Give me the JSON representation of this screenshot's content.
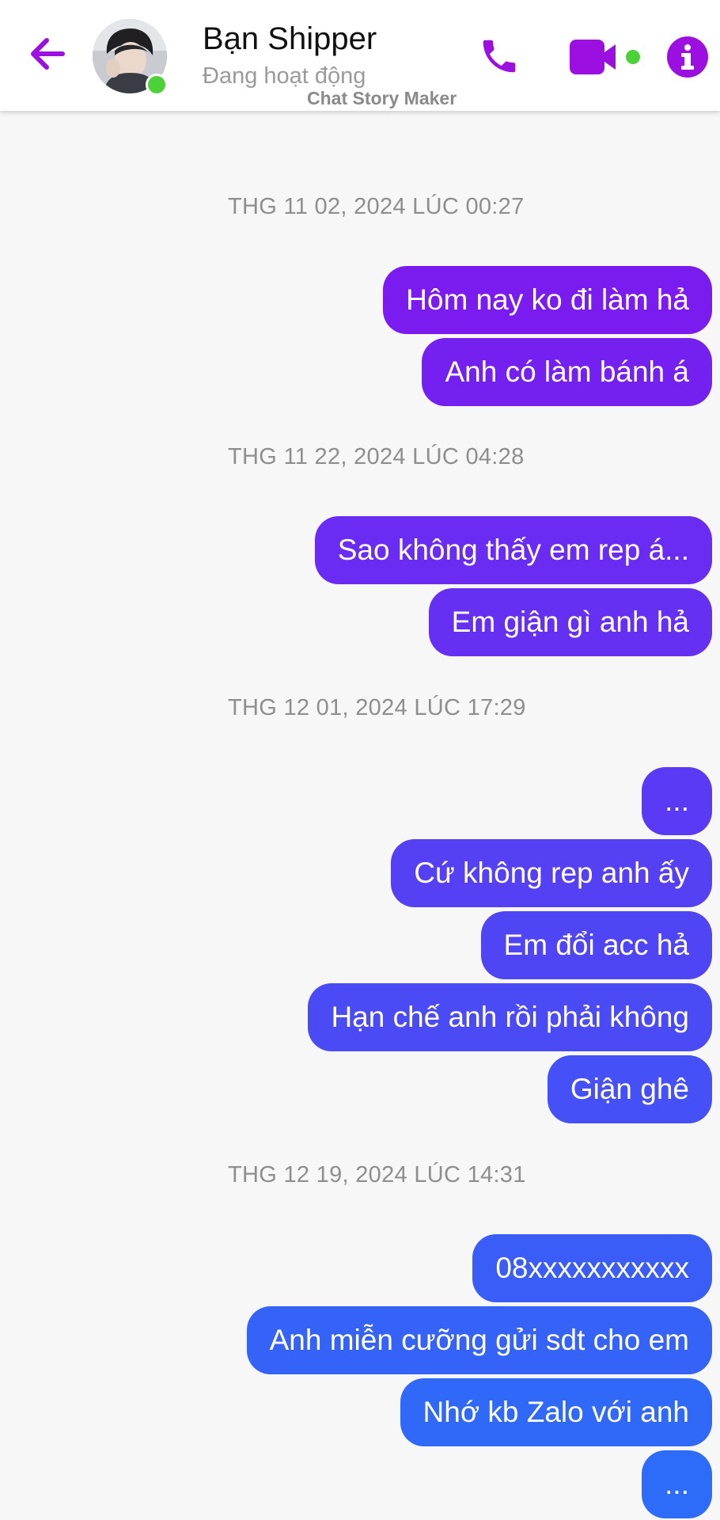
{
  "header": {
    "contact_name": "Bạn Shipper",
    "status": "Đang hoạt động",
    "watermark": "Chat Story Maker",
    "back_icon": "arrow-left-icon",
    "call_icon": "phone-icon",
    "video_icon": "video-camera-icon",
    "info_icon": "info-icon",
    "accent_color": "#9b0fe0",
    "online_color": "#4cd137"
  },
  "messages": [
    {
      "type": "timestamp",
      "text": "THG 11 02, 2024 LÚC 00:27"
    },
    {
      "type": "sent",
      "text": "Hôm nay ko đi làm hả",
      "color": "#7a1cf0"
    },
    {
      "type": "sent",
      "text": "Anh có làm bánh á",
      "color": "#7420f0"
    },
    {
      "type": "timestamp",
      "text": "THG 11 22, 2024 LÚC 04:28"
    },
    {
      "type": "sent",
      "text": "Sao không thấy em rep á...",
      "color": "#6a2bf2"
    },
    {
      "type": "sent",
      "text": "Em giận gì anh hả",
      "color": "#6530f2"
    },
    {
      "type": "timestamp",
      "text": "THG 12 01, 2024 LÚC 17:29"
    },
    {
      "type": "sent",
      "text": "...",
      "color": "#5a3af4"
    },
    {
      "type": "sent",
      "text": "Cứ không rep anh ấy",
      "color": "#5540f4"
    },
    {
      "type": "sent",
      "text": "Em đổi acc hả",
      "color": "#5045f5"
    },
    {
      "type": "sent",
      "text": "Hạn chế anh rồi phải không",
      "color": "#4a4bf5"
    },
    {
      "type": "sent",
      "text": "Giận ghê",
      "color": "#4550f6"
    },
    {
      "type": "timestamp",
      "text": "THG 12 19, 2024 LÚC 14:31"
    },
    {
      "type": "sent",
      "text": "08xxxxxxxxxxx",
      "color": "#3a5cf7"
    },
    {
      "type": "sent",
      "text": "Anh miễn cưỡng gửi sdt cho em",
      "color": "#3562f7"
    },
    {
      "type": "sent",
      "text": "Nhớ kb Zalo với anh",
      "color": "#3068f8"
    },
    {
      "type": "sent",
      "text": "...",
      "color": "#2d6cf8"
    }
  ]
}
